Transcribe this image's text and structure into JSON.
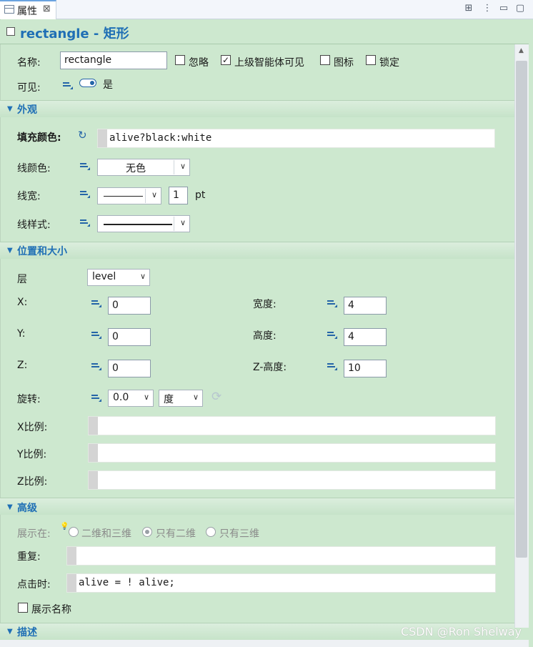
{
  "tab": {
    "label": "属性",
    "close": "⊠"
  },
  "toolbar": {
    "btn1": "⊞",
    "btn2": "⋮",
    "btn3": "▭",
    "btn4": "▢"
  },
  "title": "rectangle - 矩形",
  "general": {
    "name_label": "名称:",
    "name_value": "rectangle",
    "ignore": "忽略",
    "visible_upper": "上级智能体可见",
    "icon": "图标",
    "lock": "锁定",
    "visible_label": "可见:",
    "visible_value": "是"
  },
  "appearance": {
    "header": "外观",
    "fill_label": "填充颜色:",
    "fill_value": "alive?black:white",
    "line_color_label": "线颜色:",
    "line_color_value": "无色",
    "line_width_label": "线宽:",
    "line_width_value": "1",
    "line_width_unit": "pt",
    "line_style_label": "线样式:"
  },
  "position": {
    "header": "位置和大小",
    "layer_label": "层",
    "layer_value": "level",
    "x_label": "X:",
    "x_value": "0",
    "y_label": "Y:",
    "y_value": "0",
    "z_label": "Z:",
    "z_value": "0",
    "width_label": "宽度:",
    "width_value": "4",
    "height_label": "高度:",
    "height_value": "4",
    "zheight_label": "Z-高度:",
    "zheight_value": "10",
    "rotation_label": "旋转:",
    "rotation_value": "0.0",
    "rotation_unit": "度",
    "xscale_label": "X比例:",
    "yscale_label": "Y比例:",
    "zscale_label": "Z比例:"
  },
  "advanced": {
    "header": "高级",
    "show_in_label": "展示在:",
    "opt_2d3d": "二维和三维",
    "opt_2d": "只有二维",
    "opt_3d": "只有三维",
    "repeat_label": "重复:",
    "on_click_label": "点击时:",
    "on_click_value": "alive = ! alive;",
    "show_name": "展示名称"
  },
  "description": {
    "header": "描述"
  },
  "watermark": "CSDN @Ron Shelway"
}
